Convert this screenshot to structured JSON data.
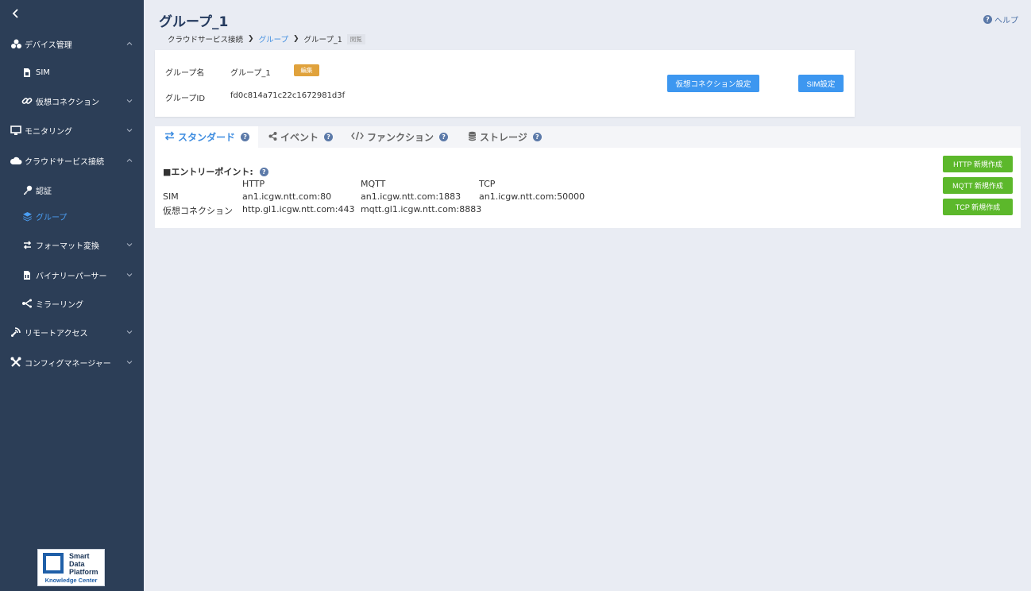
{
  "sidebar": {
    "items": [
      {
        "label": "デバイス管理",
        "icon": "devices-icon"
      },
      {
        "label": "SIM",
        "icon": "sim-card-icon"
      },
      {
        "label": "仮想コネクション",
        "icon": "link-icon"
      },
      {
        "label": "モニタリング",
        "icon": "monitor-icon"
      },
      {
        "label": "クラウドサービス接続",
        "icon": "cloud-icon"
      },
      {
        "label": "認証",
        "icon": "key-icon"
      },
      {
        "label": "グループ",
        "icon": "layers-icon"
      },
      {
        "label": "フォーマット変換",
        "icon": "convert-icon"
      },
      {
        "label": "バイナリーパーサー",
        "icon": "binary-file-icon"
      },
      {
        "label": "ミラーリング",
        "icon": "mirror-icon"
      },
      {
        "label": "リモートアクセス",
        "icon": "remote-icon"
      },
      {
        "label": "コンフィグマネージャー",
        "icon": "tools-icon"
      }
    ],
    "active_color": "#4b9ff5",
    "logo": {
      "line1": "Smart",
      "line2": "Data",
      "line3": "Platform",
      "subtitle": "Knowledge Center"
    }
  },
  "header": {
    "title": "グループ_1",
    "help_label": "ヘルプ"
  },
  "breadcrumb": {
    "items": [
      "クラウドサービス接続",
      "グループ",
      "グループ_1"
    ],
    "tag": "閲覧"
  },
  "info": {
    "name_label": "グループ名",
    "name_value": "グループ_1",
    "edit_label": "編集",
    "id_label": "グループID",
    "id_value": "fd0c814a71c22c1672981d3f",
    "vc_settings_label": "仮想コネクション設定",
    "sim_settings_label": "SIM設定"
  },
  "tabs": [
    {
      "label": "スタンダード",
      "icon": "arrows-exchange-icon",
      "active": true
    },
    {
      "label": "イベント",
      "icon": "share-icon",
      "active": false
    },
    {
      "label": "ファンクション",
      "icon": "code-icon",
      "active": false
    },
    {
      "label": "ストレージ",
      "icon": "database-icon",
      "active": false
    }
  ],
  "endpoints": {
    "title": "■エントリーポイント:",
    "columns": [
      "HTTP",
      "MQTT",
      "TCP"
    ],
    "rows": [
      {
        "label": "SIM",
        "values": [
          "an1.icgw.ntt.com:80",
          "an1.icgw.ntt.com:1883",
          "an1.icgw.ntt.com:50000"
        ]
      },
      {
        "label": "仮想コネクション",
        "values": [
          "http.gl1.icgw.ntt.com:443",
          "mqtt.gl1.icgw.ntt.com:8883",
          ""
        ]
      }
    ]
  },
  "create_buttons": [
    "HTTP 新規作成",
    "MQTT 新規作成",
    "TCP 新規作成"
  ],
  "colors": {
    "sidebar_bg": "#2c3e57",
    "page_bg": "#e9ecf3",
    "edit_button": "#e0a23c",
    "blue_button": "#3d97f0",
    "green_button": "#5cb82b",
    "title": "#243a5e"
  }
}
